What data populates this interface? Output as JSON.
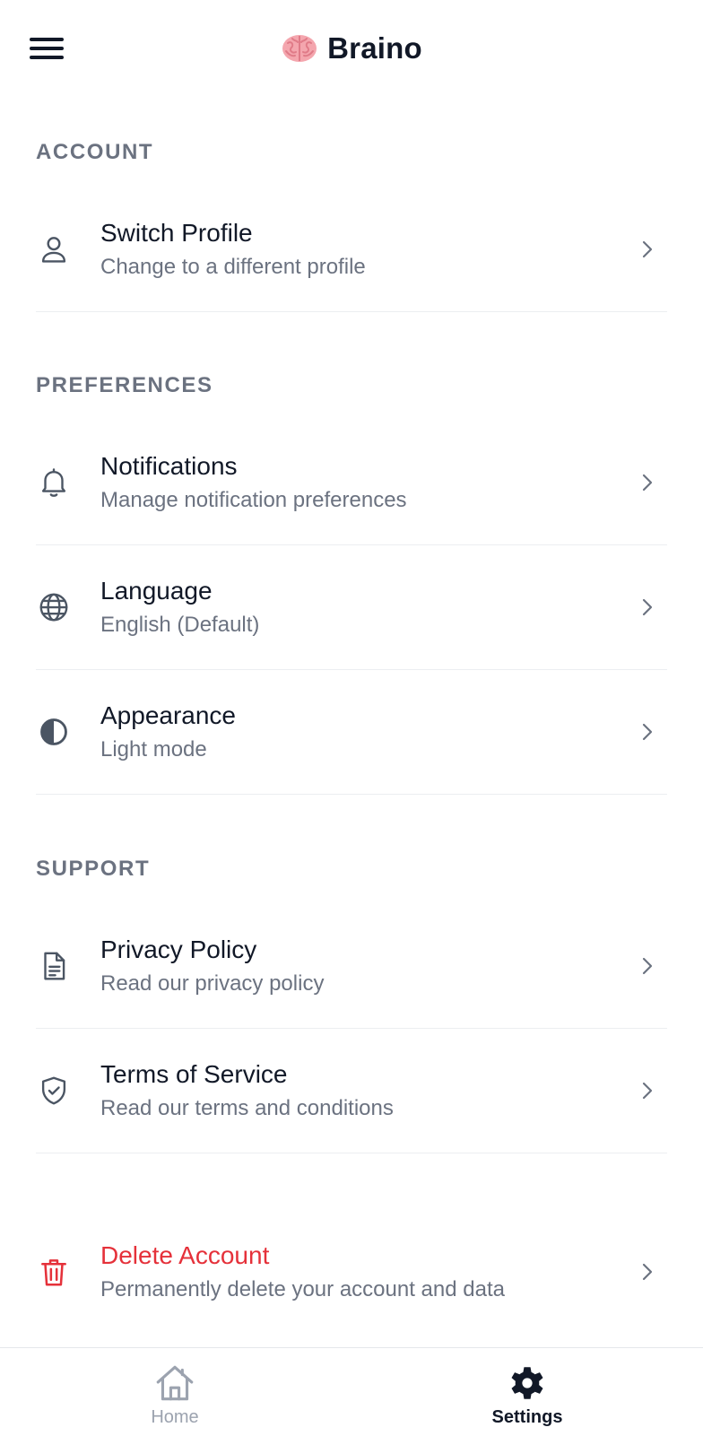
{
  "app": {
    "title": "Braino",
    "logo_icon": "brain-icon"
  },
  "colors": {
    "text_primary": "#111827",
    "text_secondary": "#6b7280",
    "danger": "#e5313a",
    "nav_inactive": "#9ca3af"
  },
  "sections": {
    "account": {
      "title": "ACCOUNT",
      "items": [
        {
          "icon": "user-icon",
          "title": "Switch Profile",
          "subtitle": "Change to a different profile"
        }
      ]
    },
    "preferences": {
      "title": "PREFERENCES",
      "items": [
        {
          "icon": "bell-icon",
          "title": "Notifications",
          "subtitle": "Manage notification preferences"
        },
        {
          "icon": "globe-icon",
          "title": "Language",
          "subtitle": "English (Default)"
        },
        {
          "icon": "half-circle-contrast-icon",
          "title": "Appearance",
          "subtitle": "Light mode"
        }
      ]
    },
    "support": {
      "title": "SUPPORT",
      "items": [
        {
          "icon": "document-icon",
          "title": "Privacy Policy",
          "subtitle": "Read our privacy policy"
        },
        {
          "icon": "shield-check-icon",
          "title": "Terms of Service",
          "subtitle": "Read our terms and conditions"
        }
      ]
    },
    "danger": {
      "items": [
        {
          "icon": "trash-icon",
          "title": "Delete Account",
          "subtitle": "Permanently delete your account and data"
        }
      ]
    }
  },
  "bottom_nav": {
    "items": [
      {
        "icon": "home-icon",
        "label": "Home",
        "active": false
      },
      {
        "icon": "gear-icon",
        "label": "Settings",
        "active": true
      }
    ]
  }
}
